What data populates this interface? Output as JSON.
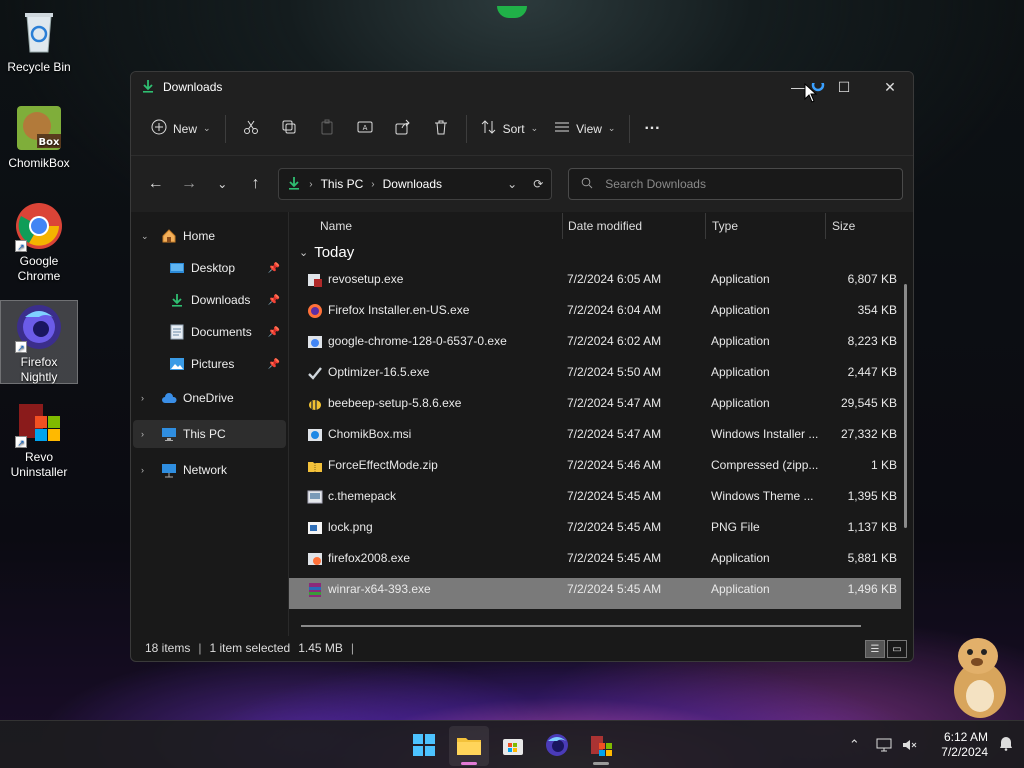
{
  "desktop": {
    "icons": [
      {
        "label": "Recycle Bin"
      },
      {
        "label": "ChomikBox"
      },
      {
        "label": "Google Chrome"
      },
      {
        "label": "Firefox Nightly"
      },
      {
        "label": "Revo Uninstaller"
      }
    ]
  },
  "window": {
    "title": "Downloads",
    "caption": {
      "minimize": "—",
      "maximize": "☐",
      "close": "✕"
    },
    "toolbar": {
      "new_label": "New",
      "sort_label": "Sort",
      "view_label": "View",
      "more_label": "···"
    },
    "address": {
      "crumbs": [
        "This PC",
        "Downloads"
      ]
    },
    "search": {
      "placeholder": "Search Downloads"
    },
    "sidebar": {
      "items": [
        {
          "label": "Home"
        },
        {
          "label": "Desktop"
        },
        {
          "label": "Downloads"
        },
        {
          "label": "Documents"
        },
        {
          "label": "Pictures"
        },
        {
          "label": "OneDrive"
        },
        {
          "label": "This PC"
        },
        {
          "label": "Network"
        }
      ]
    },
    "columns": {
      "name": "Name",
      "date": "Date modified",
      "type": "Type",
      "size": "Size"
    },
    "group": "Today",
    "files": [
      {
        "name": "revosetup.exe",
        "date": "7/2/2024 6:05 AM",
        "type": "Application",
        "size": "6,807 KB"
      },
      {
        "name": "Firefox Installer.en-US.exe",
        "date": "7/2/2024 6:04 AM",
        "type": "Application",
        "size": "354 KB"
      },
      {
        "name": "google-chrome-128-0-6537-0.exe",
        "date": "7/2/2024 6:02 AM",
        "type": "Application",
        "size": "8,223 KB"
      },
      {
        "name": "Optimizer-16.5.exe",
        "date": "7/2/2024 5:50 AM",
        "type": "Application",
        "size": "2,447 KB"
      },
      {
        "name": "beebeep-setup-5.8.6.exe",
        "date": "7/2/2024 5:47 AM",
        "type": "Application",
        "size": "29,545 KB"
      },
      {
        "name": "ChomikBox.msi",
        "date": "7/2/2024 5:47 AM",
        "type": "Windows Installer ...",
        "size": "27,332 KB"
      },
      {
        "name": "ForceEffectMode.zip",
        "date": "7/2/2024 5:46 AM",
        "type": "Compressed (zipp...",
        "size": "1 KB"
      },
      {
        "name": "c.themepack",
        "date": "7/2/2024 5:45 AM",
        "type": "Windows Theme ...",
        "size": "1,395 KB"
      },
      {
        "name": "lock.png",
        "date": "7/2/2024 5:45 AM",
        "type": "PNG File",
        "size": "1,137 KB"
      },
      {
        "name": "firefox2008.exe",
        "date": "7/2/2024 5:45 AM",
        "type": "Application",
        "size": "5,881 KB"
      },
      {
        "name": "winrar-x64-393.exe",
        "date": "7/2/2024 5:45 AM",
        "type": "Application",
        "size": "1,496 KB"
      }
    ],
    "status": {
      "items": "18 items",
      "selected": "1 item selected",
      "size": "1.45 MB"
    }
  },
  "taskbar": {
    "time": "6:12 AM",
    "date": "7/2/2024"
  },
  "colors": {
    "accent": "#60cdff",
    "download_green": "#2fbf71",
    "folder_yellow": "#f3c13a"
  }
}
